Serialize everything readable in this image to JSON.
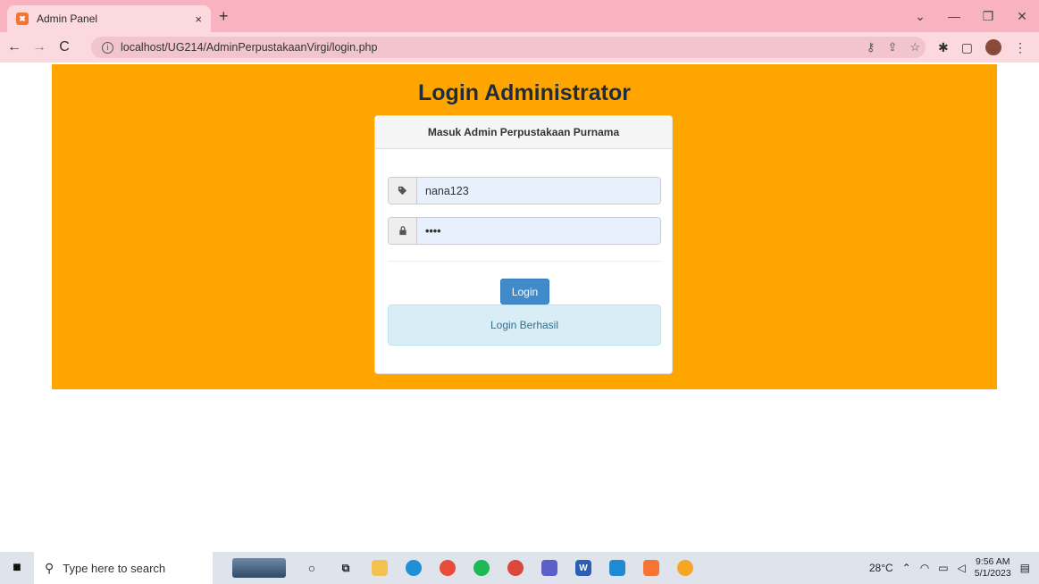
{
  "browser": {
    "tab_title": "Admin Panel",
    "tab_close": "×",
    "new_tab": "+",
    "favicon_label": "✖",
    "url": "localhost/UG214/AdminPerpustakaanVirgi/login.php",
    "window_controls": [
      "⌄",
      "—",
      "❐",
      "✕"
    ]
  },
  "page": {
    "heading": "Login Administrator",
    "panel_title": "Masuk Admin Perpustakaan Purnama",
    "username_value": "nana123",
    "password_value": "••••",
    "login_button": "Login",
    "alert_text": "Login Berhasil"
  },
  "taskbar": {
    "search_placeholder": "Type here to search",
    "weather": "28°C",
    "time": "9:56 AM",
    "date": "5/1/2023"
  }
}
